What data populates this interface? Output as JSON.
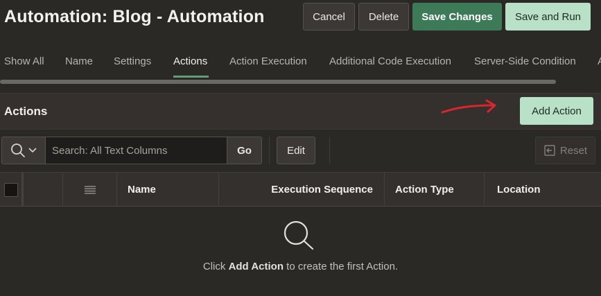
{
  "header": {
    "title": "Automation: Blog - Automation",
    "cancel_label": "Cancel",
    "delete_label": "Delete",
    "save_label": "Save Changes",
    "save_run_label": "Save and Run"
  },
  "tabs": {
    "items": [
      {
        "label": "Show All"
      },
      {
        "label": "Name"
      },
      {
        "label": "Settings"
      },
      {
        "label": "Actions"
      },
      {
        "label": "Action Execution"
      },
      {
        "label": "Additional Code Execution"
      },
      {
        "label": "Server-Side Condition"
      },
      {
        "label": "A"
      }
    ],
    "active": "Actions"
  },
  "region": {
    "title": "Actions",
    "add_action_label": "Add Action"
  },
  "toolbar": {
    "search_placeholder": "Search: All Text Columns",
    "go_label": "Go",
    "edit_label": "Edit",
    "reset_label": "Reset"
  },
  "grid": {
    "columns": [
      "Name",
      "Execution Sequence",
      "Action Type",
      "Location"
    ]
  },
  "empty_state": {
    "prefix": "Click ",
    "emphasis": "Add Action",
    "suffix": " to create the first Action."
  },
  "icons": {
    "search": "search-icon",
    "chevron": "chevron-down-icon",
    "menu": "hamburger-menu-icon",
    "reset": "reset-icon",
    "annotation": "red-arrow-annotation"
  },
  "colors": {
    "background": "#2b2926",
    "hot_button": "#3d7a57",
    "light_button": "#b9e1c8",
    "annotation": "#d8262b"
  }
}
